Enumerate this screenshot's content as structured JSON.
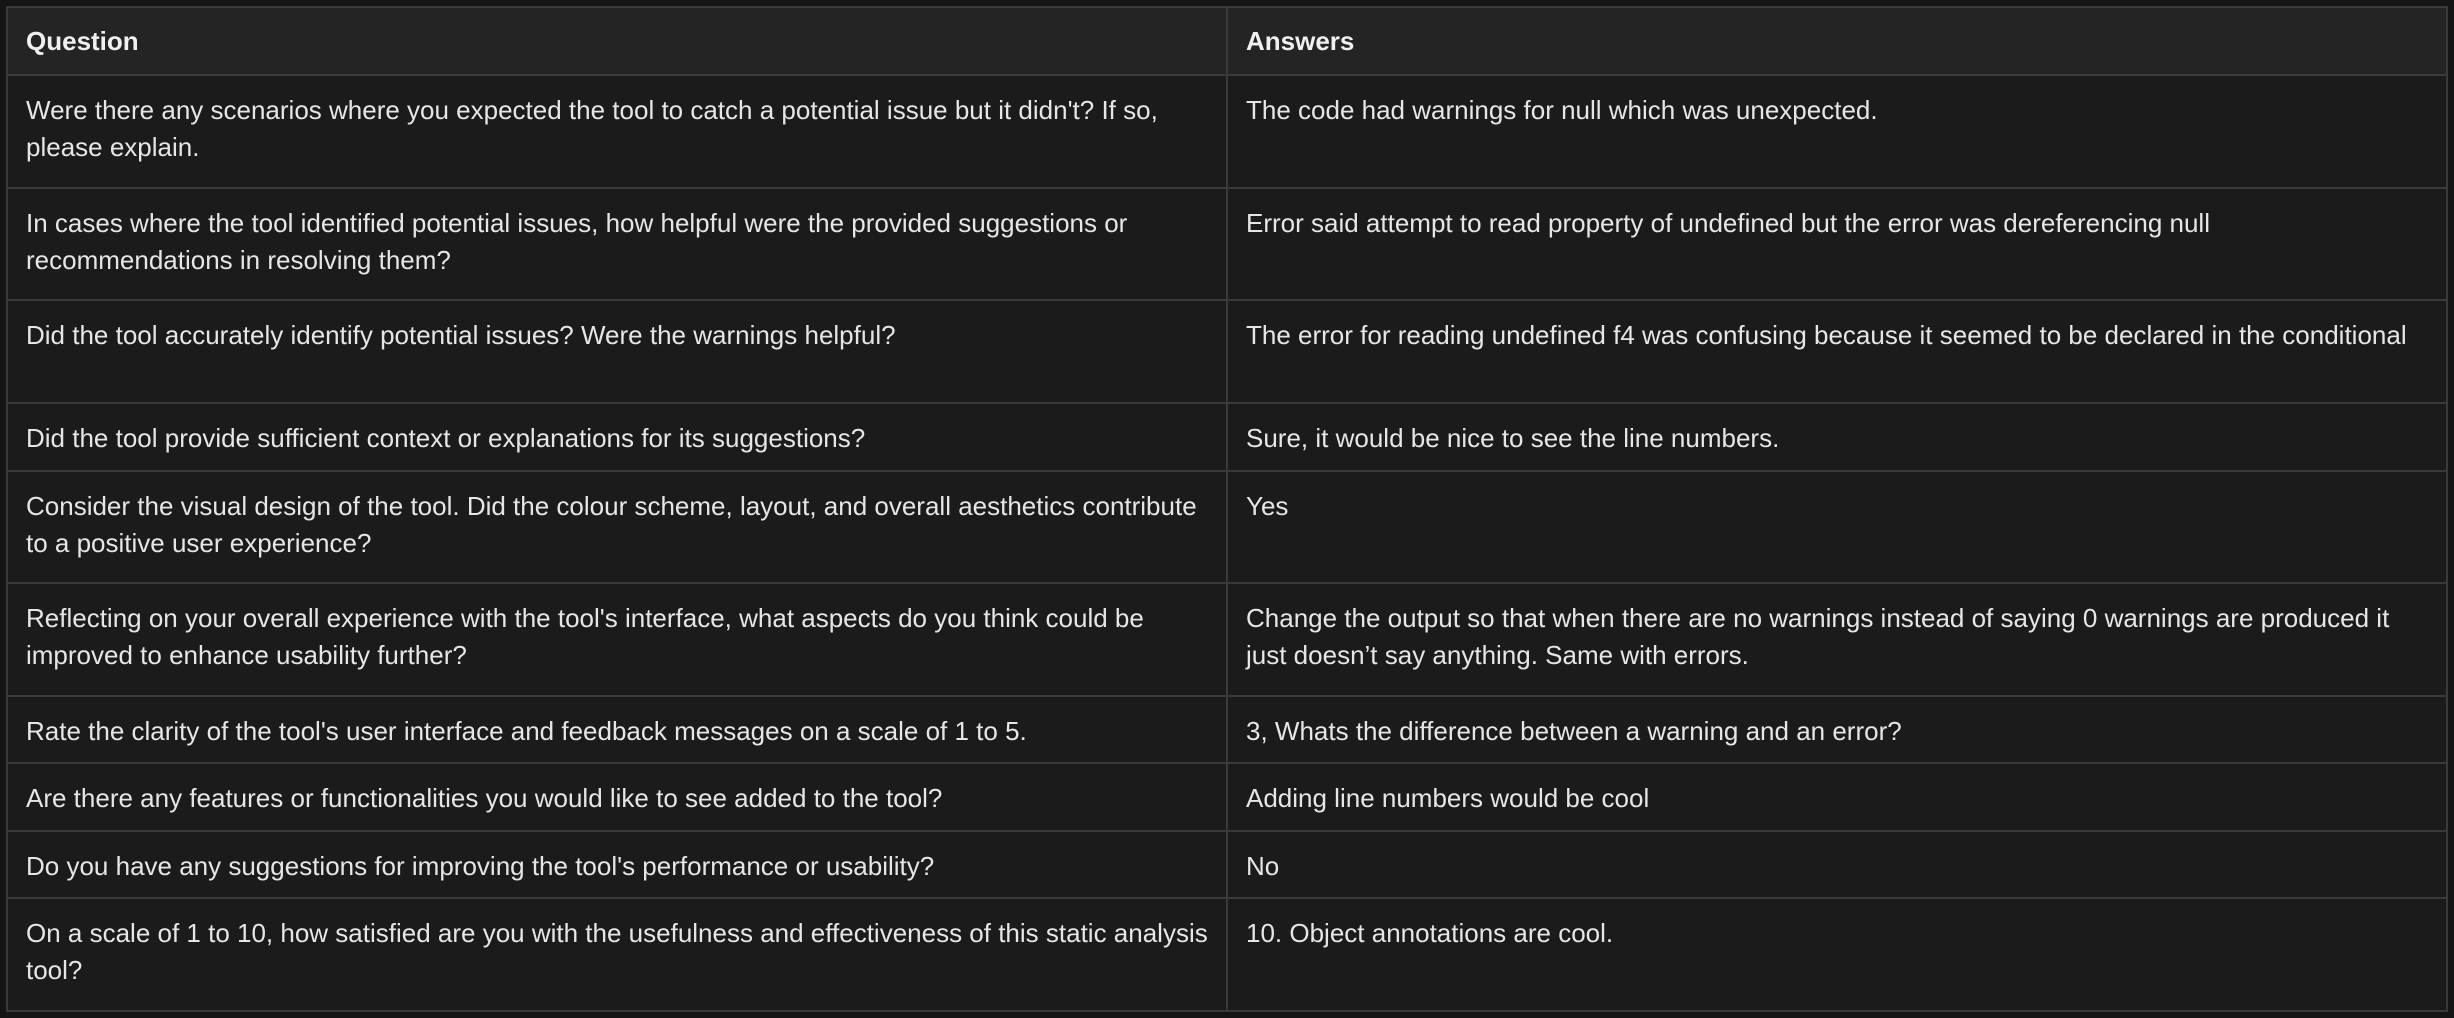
{
  "table": {
    "headers": [
      "Question",
      "Answers"
    ],
    "rows": [
      {
        "question": "Were there any scenarios where you expected the tool to catch a potential issue but it didn't? If so, please explain.",
        "answer": "The code had warnings for null which was unexpected."
      },
      {
        "question": "In cases where the tool identified potential issues, how helpful were the provided suggestions or recommendations in resolving them?",
        "answer": "Error said attempt to read property of undefined but the error was dereferencing null"
      },
      {
        "question": "Did the tool accurately identify potential issues? Were the warnings helpful?",
        "answer": "The error for reading undefined f4 was confusing because it seemed to be declared in the conditional"
      },
      {
        "question": "Did the tool provide sufficient context or explanations for its suggestions?",
        "answer": "Sure, it would be nice to see the line numbers."
      },
      {
        "question": "Consider the visual design of the tool. Did the colour scheme, layout, and overall aesthetics contribute to a positive user experience?",
        "answer": "Yes"
      },
      {
        "question": "Reflecting on your overall experience with the tool's interface, what aspects do you think could be improved to enhance usability further?",
        "answer": "Change the output so that when there are no warnings instead of saying 0 warnings are produced it just doesn’t say anything. Same with errors."
      },
      {
        "question": "Rate the clarity of the tool's user interface and feedback messages on a scale of 1 to 5.",
        "answer": "3, Whats the difference between a warning and an error?"
      },
      {
        "question": "Are there any features or functionalities you would like to see added to the tool?",
        "answer": "Adding line numbers would be cool"
      },
      {
        "question": "Do you have any suggestions for improving the tool's performance or usability?",
        "answer": "No"
      },
      {
        "question": "On a scale of 1 to 10, how satisfied are you with the usefulness and effectiveness of this static analysis tool?",
        "answer": "10. Object annotations are cool."
      }
    ]
  },
  "colors": {
    "background": "#151515",
    "header_background": "#242424",
    "cell_background": "#1b1b1b",
    "border": "#3a3a3a",
    "text": "#e6e6e6"
  }
}
